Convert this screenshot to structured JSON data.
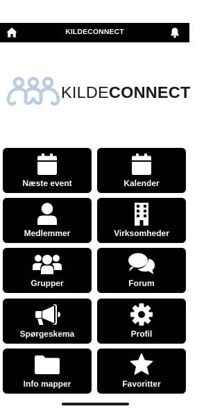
{
  "header": {
    "title": "KILDECONNECT",
    "left_icon": "home-icon",
    "right_icon": "bell-icon"
  },
  "logo": {
    "text_light": "KILDE",
    "text_bold": "CONNECT",
    "mark_color": "#b8cfe3"
  },
  "menu": {
    "items": [
      {
        "label": "Næste event",
        "icon": "calendar-icon"
      },
      {
        "label": "Kalender",
        "icon": "calendar-icon"
      },
      {
        "label": "Medlemmer",
        "icon": "user-icon"
      },
      {
        "label": "Virksomheder",
        "icon": "building-icon"
      },
      {
        "label": "Grupper",
        "icon": "users-icon"
      },
      {
        "label": "Forum",
        "icon": "comments-icon"
      },
      {
        "label": "Spørgeskema",
        "icon": "megaphone-icon"
      },
      {
        "label": "Profil",
        "icon": "gear-icon"
      },
      {
        "label": "Info mapper",
        "icon": "folder-icon"
      },
      {
        "label": "Favoritter",
        "icon": "star-icon"
      }
    ]
  },
  "colors": {
    "tile_background": "#000000",
    "tile_text": "#ffffff",
    "header_background": "#000000"
  }
}
